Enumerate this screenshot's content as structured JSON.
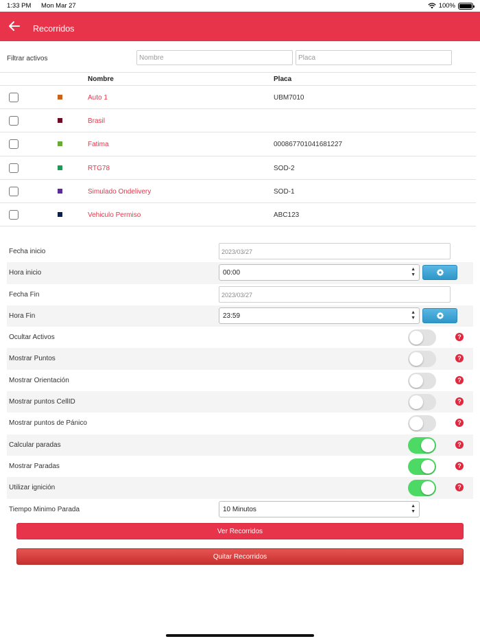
{
  "status_bar": {
    "time": "1:33 PM",
    "date": "Mon Mar 27",
    "battery": "100%"
  },
  "navbar": {
    "title": "Recorridos"
  },
  "filter": {
    "label": "Filtrar activos",
    "name_placeholder": "Nombre",
    "plate_placeholder": "Placa"
  },
  "table": {
    "headers": {
      "name": "Nombre",
      "plate": "Placa"
    },
    "rows": [
      {
        "name": "Auto 1",
        "plate": "UBM7010",
        "color": "#c8641e"
      },
      {
        "name": "Brasil",
        "plate": "",
        "color": "#6b0e25"
      },
      {
        "name": "Fatima",
        "plate": "000867701041681227",
        "color": "#6aa83c"
      },
      {
        "name": "RTG78",
        "plate": "SOD-2",
        "color": "#1e9a55"
      },
      {
        "name": "Simulado Ondelivery",
        "plate": "SOD-1",
        "color": "#5b2c99"
      },
      {
        "name": "Vehiculo Permiso",
        "plate": "ABC123",
        "color": "#0d1f4d"
      }
    ]
  },
  "form": {
    "fecha_inicio": {
      "label": "Fecha inicio",
      "value": "2023/03/27"
    },
    "hora_inicio": {
      "label": "Hora inicio",
      "value": "00:00"
    },
    "fecha_fin": {
      "label": "Fecha Fin",
      "value": "2023/03/27"
    },
    "hora_fin": {
      "label": "Hora Fin",
      "value": "23:59"
    },
    "toggles": [
      {
        "label": "Ocultar Activos",
        "on": false
      },
      {
        "label": "Mostrar Puntos",
        "on": false
      },
      {
        "label": "Mostrar Orientación",
        "on": false
      },
      {
        "label": "Mostrar puntos CellID",
        "on": false
      },
      {
        "label": "Mostrar puntos de Pánico",
        "on": false
      },
      {
        "label": "Calcular paradas",
        "on": true
      },
      {
        "label": "Mostrar Paradas",
        "on": true
      },
      {
        "label": "Utilizar ignición",
        "on": true
      }
    ],
    "tiempo_minimo": {
      "label": "Tiempo Minimo Parada",
      "value": "10 Minutos"
    }
  },
  "buttons": {
    "ver": "Ver Recorridos",
    "quitar": "Quitar Recorridos"
  },
  "help_symbol": "?"
}
